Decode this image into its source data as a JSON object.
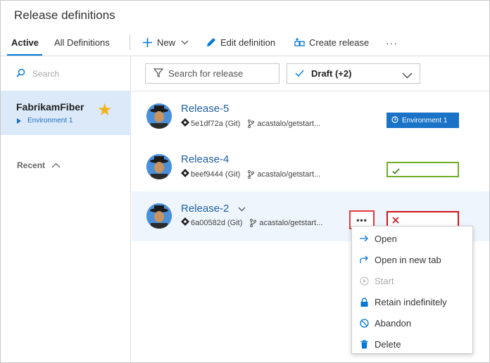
{
  "page": {
    "title": "Release definitions"
  },
  "tabs": [
    {
      "label": "Active",
      "active": true
    },
    {
      "label": "All Definitions",
      "active": false
    }
  ],
  "toolbar": {
    "new_label": "New",
    "edit_label": "Edit definition",
    "create_label": "Create release",
    "more_label": "···"
  },
  "left": {
    "search_placeholder": "Search",
    "definition": {
      "name": "FabrikamFiber",
      "environment": "Environment 1",
      "favorite": true
    },
    "recent_label": "Recent"
  },
  "filters": {
    "search_placeholder": "Search for release",
    "status_value": "Draft (+2)"
  },
  "releases": [
    {
      "name": "Release-5",
      "commit": "5e1df72a (Git)",
      "branch": "acastalo/getstart...",
      "env_status": "in-progress",
      "env_label": "Environment 1"
    },
    {
      "name": "Release-4",
      "commit": "beef9444 (Git)",
      "branch": "acastalo/getstart...",
      "env_status": "succeeded",
      "env_label": ""
    },
    {
      "name": "Release-2",
      "commit": "6a00582d (Git)",
      "branch": "acastalo/getstart...",
      "env_status": "failed",
      "env_label": ""
    }
  ],
  "row_more_label": "•••",
  "context_menu": [
    {
      "label": "Open",
      "icon": "arrow-right-icon",
      "enabled": true
    },
    {
      "label": "Open in new tab",
      "icon": "redirect-icon",
      "enabled": true
    },
    {
      "label": "Start",
      "icon": "play-icon",
      "enabled": false
    },
    {
      "label": "Retain indefinitely",
      "icon": "lock-icon",
      "enabled": true
    },
    {
      "label": "Abandon",
      "icon": "cancel-icon",
      "enabled": true
    },
    {
      "label": "Delete",
      "icon": "trash-icon",
      "enabled": true
    }
  ],
  "colors": {
    "accent": "#0078d7",
    "link": "#1f5f9f",
    "selected_bg": "#dbe9f8",
    "in_progress": "#1a73c7",
    "succeeded": "#70ad2a",
    "failed": "#d0141b",
    "favorite_star": "#f2b318"
  }
}
